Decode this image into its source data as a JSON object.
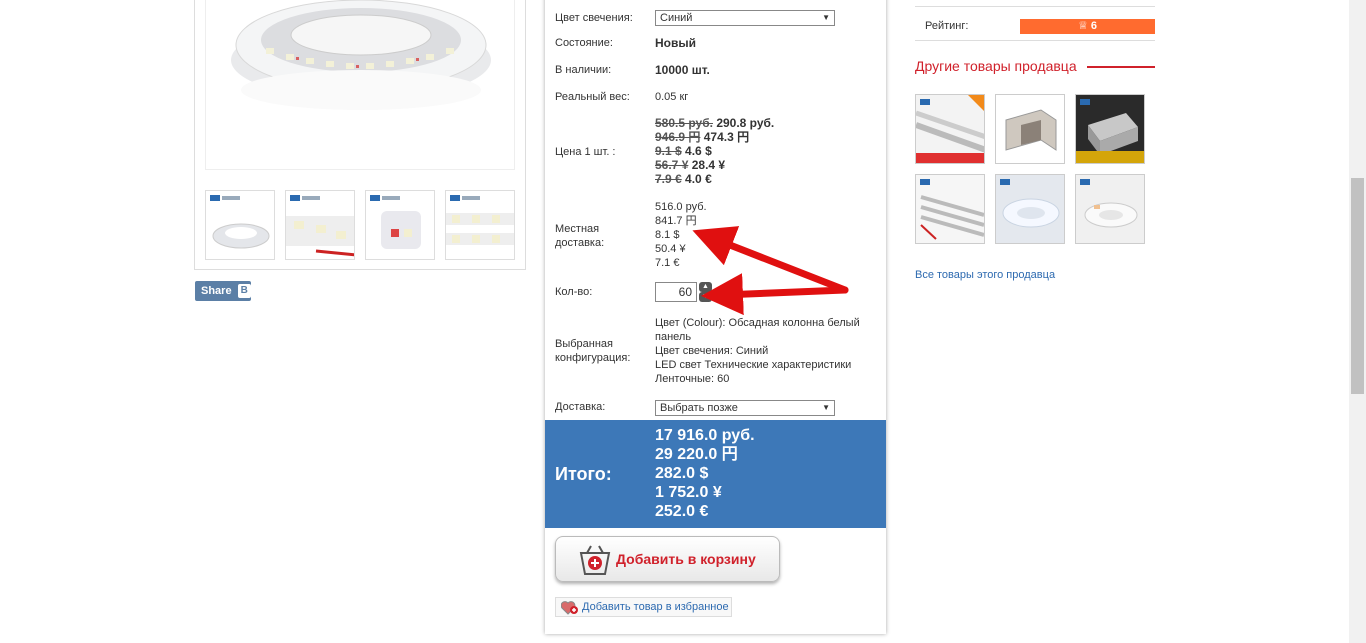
{
  "share": {
    "label": "Share",
    "vk": "B"
  },
  "options": {
    "glow_color_label": "Цвет свечения:",
    "glow_color_value": "Синий",
    "condition_label": "Состояние:",
    "condition_value": "Новый",
    "stock_label": "В наличии:",
    "stock_value": "10000 шт.",
    "weight_label": "Реальный вес:",
    "weight_value": "0.05 кг"
  },
  "price": {
    "label": "Цена 1 шт. :",
    "lines": [
      {
        "old": "580.5 руб.",
        "new": "290.8 руб."
      },
      {
        "old": "946.9 円",
        "new": "474.3 円"
      },
      {
        "old": "9.1 $",
        "new": "4.6 $"
      },
      {
        "old": "56.7 ¥",
        "new": "28.4 ¥"
      },
      {
        "old": "7.9 €",
        "new": "4.0 €"
      }
    ]
  },
  "shipping_local": {
    "label_line1": "Местная",
    "label_line2": "доставка:",
    "values": [
      "516.0 руб.",
      "841.7 円",
      "8.1 $",
      "50.4 ¥",
      "7.1 €"
    ]
  },
  "quantity": {
    "label": "Кол-во:",
    "value": "60"
  },
  "config": {
    "label_line1": "Выбранная",
    "label_line2": "конфигурация:",
    "lines": [
      "Цвет (Colour): Обсадная колонна белый",
      "панель",
      "Цвет свечения: Синий",
      "LED свет Технические характеристики",
      "Ленточные: 60"
    ]
  },
  "delivery": {
    "label": "Доставка:",
    "value": "Выбрать позже"
  },
  "total": {
    "label": "Итого:",
    "values": [
      "17 916.0 руб.",
      "29 220.0 円",
      "282.0 $",
      "1 752.0 ¥",
      "252.0 €"
    ]
  },
  "cart": {
    "label": "Добавить в корзину"
  },
  "favorite": {
    "label": "Добавить товар в избранное"
  },
  "seller": {
    "rating_label": "Рейтинг:",
    "rating_value": "6",
    "other_title": "Другие товары продавца",
    "all_link": "Все товары этого продавца"
  },
  "colors": {
    "accent_red": "#d0212b",
    "total_blue": "#3d78b8",
    "rating_orange": "#ff6b2f",
    "link_blue": "#2d6ab0"
  },
  "icons": [
    "crown-icon",
    "basket-plus-icon",
    "heart-icon",
    "dropdown-arrow-icon",
    "spin-up-icon",
    "spin-down-icon"
  ]
}
